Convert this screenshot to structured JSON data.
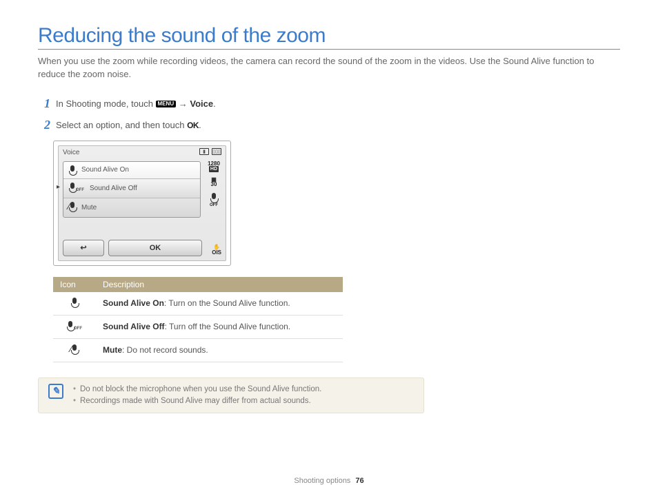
{
  "title": "Reducing the sound of the zoom",
  "intro": "When you use the zoom while recording videos, the camera can record the sound of the zoom in the videos. Use the Sound Alive function to reduce the zoom noise.",
  "steps": {
    "s1": {
      "num": "1",
      "pre": "In Shooting mode, touch ",
      "menu": "MENU",
      "arrow": " → ",
      "target": "Voice",
      "post": "."
    },
    "s2": {
      "num": "2",
      "pre": "Select an option, and then touch ",
      "ok": "OK",
      "post": "."
    }
  },
  "lcd": {
    "title": "Voice",
    "res": "1280",
    "hd": "HD",
    "fps": "30",
    "options": {
      "on": "Sound Alive On",
      "off": "Sound Alive Off",
      "mute": "Mute"
    },
    "ok": "OK",
    "off_sub": "OFF",
    "ois": "OIS"
  },
  "table": {
    "h1": "Icon",
    "h2": "Description",
    "rows": {
      "on": {
        "b": "Sound Alive On",
        "t": ": Turn on the Sound Alive function."
      },
      "off": {
        "b": "Sound Alive Off",
        "t": ": Turn off the Sound Alive function."
      },
      "mute": {
        "b": "Mute",
        "t": ": Do not record sounds."
      }
    }
  },
  "notes": {
    "n1": "Do not block the microphone when you use the Sound Alive function.",
    "n2": "Recordings made with Sound Alive may differ from actual sounds."
  },
  "footer": {
    "section": "Shooting options",
    "page": "76"
  }
}
